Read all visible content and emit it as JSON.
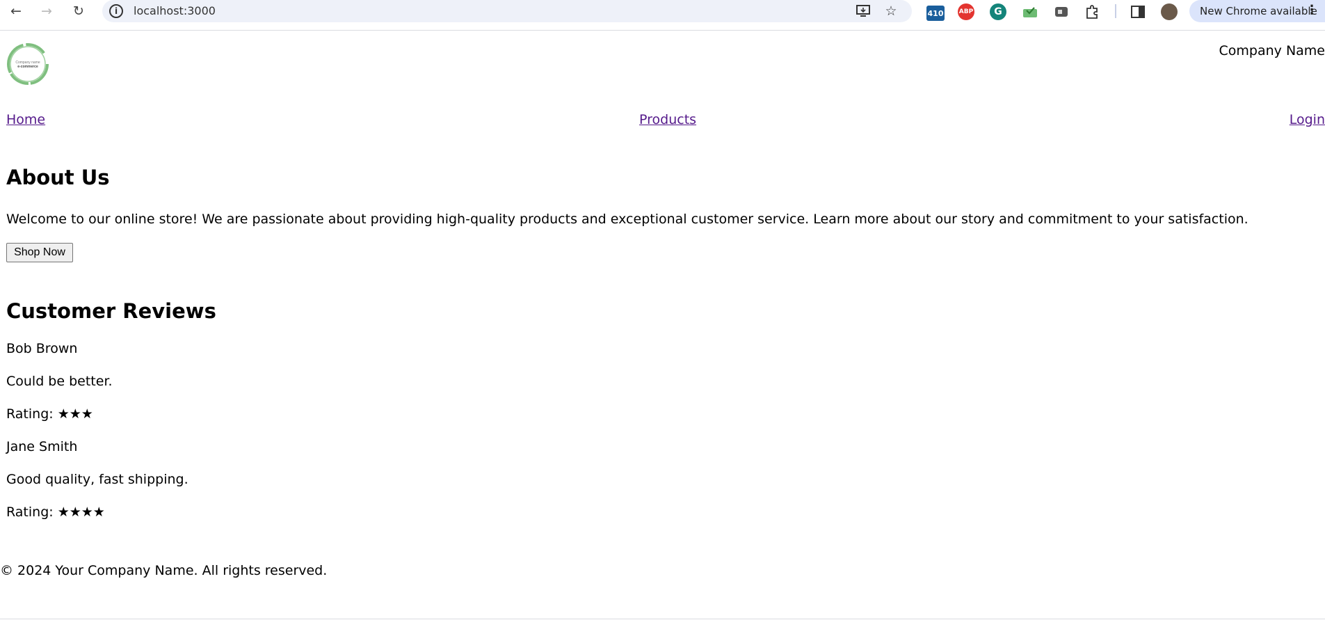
{
  "browser": {
    "url": "localhost:3000",
    "update_label": "New Chrome available",
    "extension_badge": "410",
    "abp_label": "ABP",
    "grammarly_label": "G"
  },
  "header": {
    "logo_line1": "Company name",
    "logo_line2": "e-commerce",
    "company_name": "Company Name"
  },
  "nav": {
    "home": "Home",
    "products": "Products",
    "login": "Login"
  },
  "about": {
    "title": "About Us",
    "text": "Welcome to our online store! We are passionate about providing high-quality products and exceptional customer service. Learn more about our story and commitment to your satisfaction.",
    "button": "Shop Now"
  },
  "reviews": {
    "title": "Customer Reviews",
    "items": [
      {
        "name": "Bob Brown",
        "comment": "Could be better.",
        "rating": "Rating: ★★★"
      },
      {
        "name": "Jane Smith",
        "comment": "Good quality, fast shipping.",
        "rating": "Rating: ★★★★"
      }
    ]
  },
  "footer": {
    "text": "© 2024 Your Company Name. All rights reserved."
  },
  "colors": {
    "link": "#551a8b",
    "logo_green": "#7fbf7f",
    "omnibox_bg": "#eef1f9",
    "update_pill_bg": "#dbe4fb"
  }
}
